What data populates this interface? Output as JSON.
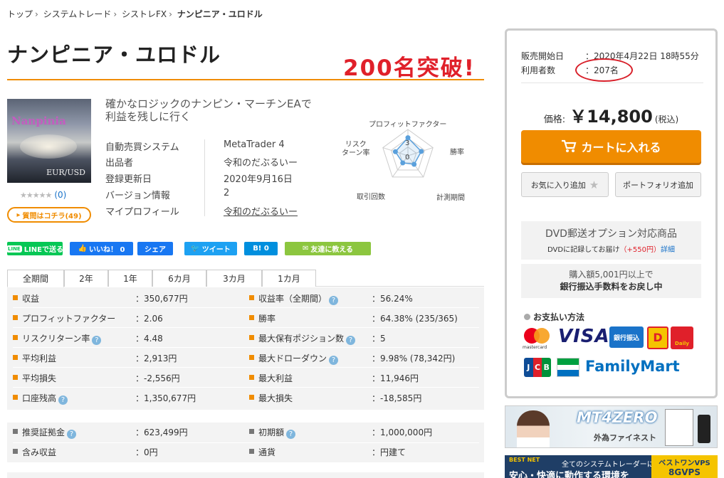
{
  "breadcrumb": [
    "トップ",
    "システムトレード",
    "シストレFX",
    "ナンピニア・ユロドル"
  ],
  "product": {
    "title": "ナンピニア・ユロドル",
    "annotation": "200名突破!",
    "thumb_title": "Nanpinia",
    "thumb_pair": "EUR/USD",
    "rating_count": "(0)",
    "question_button": "質問はコチラ(49)",
    "description": "確かなロジックのナンピン・マーチンEAで利益を残しに行く"
  },
  "info": [
    {
      "label": "自動売買システム",
      "value": "MetaTrader 4"
    },
    {
      "label": "出品者",
      "value": "令和のだぶるいー"
    },
    {
      "label": "登録更新日",
      "value": "2020年9月16日"
    },
    {
      "label": "バージョン情報",
      "value": "2"
    },
    {
      "label": "マイプロフィール",
      "value": "令和のだぶるいー"
    }
  ],
  "radar": {
    "labels": {
      "top": "プロフィットファクター",
      "right": "勝率",
      "bottom_right": "計測期間",
      "bottom_left": "取引回数",
      "left": "リスク\nターン率"
    },
    "scale": [
      "3",
      "0"
    ],
    "values": [
      2.06,
      1.6,
      1.2,
      1.0,
      1.5
    ]
  },
  "social": {
    "line": "LINEで送る",
    "like": "いいね！ 0",
    "share": "シェア",
    "tweet": "ツイート",
    "hatena": "B! 0",
    "friend": "友達に教える"
  },
  "tabs": [
    "全期間",
    "2年",
    "1年",
    "6カ月",
    "3カ月",
    "1カ月"
  ],
  "stats": [
    [
      {
        "label": "収益",
        "value": "：350,677円"
      },
      {
        "label": "収益率（全期間）",
        "value": "：56.24%",
        "help": true
      }
    ],
    [
      {
        "label": "プロフィットファクター",
        "value": "：2.06"
      },
      {
        "label": "勝率",
        "value": "：64.38% (235/365)"
      }
    ],
    [
      {
        "label": "リスクリターン率",
        "value": "：4.48",
        "help": true
      },
      {
        "label": "最大保有ポジション数",
        "value": "：5",
        "help": true
      }
    ],
    [
      {
        "label": "平均利益",
        "value": "：2,913円"
      },
      {
        "label": "最大ドローダウン",
        "value": "：9.98% (78,342円)",
        "help": true
      }
    ],
    [
      {
        "label": "平均損失",
        "value": "：-2,556円"
      },
      {
        "label": "最大利益",
        "value": "：11,946円"
      }
    ],
    [
      {
        "label": "口座残高",
        "value": "：1,350,677円",
        "help": true
      },
      {
        "label": "最大損失",
        "value": "：-18,585円"
      }
    ]
  ],
  "stats2": [
    [
      {
        "label": "推奨証拠金",
        "value": "：623,499円",
        "help": true
      },
      {
        "label": "初期額",
        "value": "：1,000,000円",
        "help": true
      }
    ],
    [
      {
        "label": "含み収益",
        "value": "：0円"
      },
      {
        "label": "通貨",
        "value": "：円建て"
      }
    ]
  ],
  "help_mark": "?",
  "sidebar": {
    "sale_start_label": "販売開始日",
    "sale_start_value": "：2020年4月22日 18時55分",
    "users_label": "利用者数",
    "users_value": "：207名",
    "price_label": "価格:",
    "price_value": "￥14,800",
    "tax": "(税込)",
    "cart_button": "カートに入れる",
    "favorite_button": "お気に入り追加",
    "portfolio_button": "ポートフォリオ追加",
    "dvd_title": "DVD郵送オプション対応商品",
    "dvd_text": "DVDに記録してお届け",
    "dvd_price": "（+550円）",
    "dvd_link": "詳細",
    "bank_line1": "購入額5,001円以上で",
    "bank_line2": "銀行振込手数料をお戻し中",
    "payment_heading": "お支払い方法",
    "payments": {
      "mastercard": "mastercard",
      "visa": "VISA",
      "bank": "銀行振込",
      "jcb": "JCB",
      "familymart": "FamilyMart",
      "daily": "Daily"
    }
  },
  "ads": {
    "ad1_title": "MT4ZERO",
    "ad1_sub": "外為ファイネスト",
    "ad2_brand": "BEST NET",
    "ad2_text": "全てのシステムトレーダーに",
    "ad2_big": "安心・快適に動作する環境を",
    "ad2_vps_top": "ベストワンVPS",
    "ad2_vps_bottom": "8GVPS"
  },
  "colors": {
    "accent": "#f08c00",
    "annotation": "#e0202a",
    "link": "#1a73c9",
    "line": "#06c755",
    "facebook": "#1877f2",
    "twitter": "#1da1f2",
    "hatena": "#008fde",
    "friend": "#8cc63f"
  }
}
